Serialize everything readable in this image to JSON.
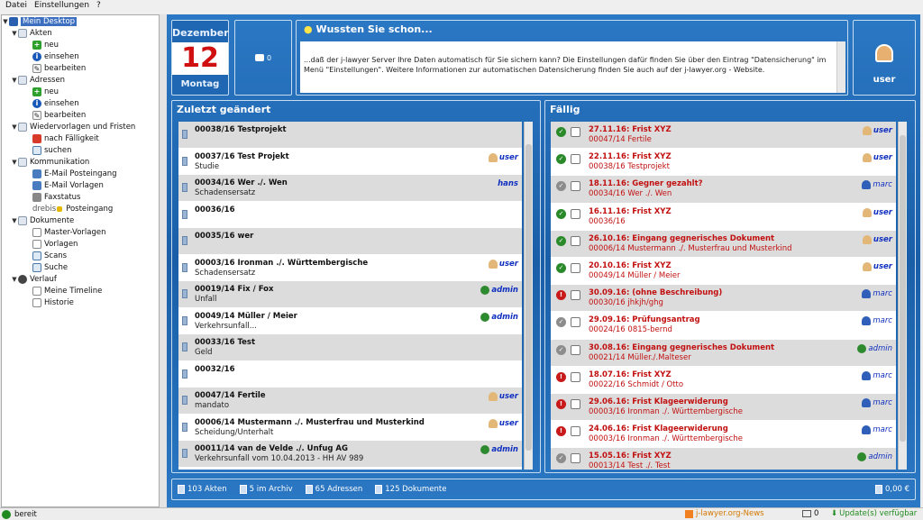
{
  "menu": {
    "file": "Datei",
    "settings": "Einstellungen",
    "help": "?"
  },
  "tree": {
    "root": "Mein Desktop",
    "akten": {
      "label": "Akten",
      "neu": "neu",
      "einsehen": "einsehen",
      "bearbeiten": "bearbeiten"
    },
    "adressen": {
      "label": "Adressen",
      "neu": "neu",
      "einsehen": "einsehen",
      "bearbeiten": "bearbeiten"
    },
    "wv": {
      "label": "Wiedervorlagen und Fristen",
      "faellig": "nach Fälligkeit",
      "suchen": "suchen"
    },
    "komm": {
      "label": "Kommunikation",
      "email_in": "E-Mail Posteingang",
      "email_tpl": "E-Mail Vorlagen",
      "fax": "Faxstatus",
      "drebis_prefix": "drebis",
      "drebis": "Posteingang"
    },
    "docs": {
      "label": "Dokumente",
      "master": "Master-Vorlagen",
      "vorlagen": "Vorlagen",
      "scans": "Scans",
      "suche": "Suche"
    },
    "verlauf": {
      "label": "Verlauf",
      "timeline": "Meine Timeline",
      "historie": "Historie"
    }
  },
  "date": {
    "month": "Dezember",
    "day": "12",
    "weekday": "Montag"
  },
  "mail": {
    "count": "0"
  },
  "tip": {
    "title": "Wussten Sie schon...",
    "text": "...daß der j-lawyer Server Ihre Daten automatisch für Sie sichern kann? Die Einstellungen dafür finden Sie über den Eintrag \"Datensicherung\" im Menü \"Einstellungen\". Weitere Informationen zur automatischen Datensicherung finden Sie auch auf der j-lawyer.org - Website."
  },
  "user": {
    "name": "user"
  },
  "recent": {
    "title": "Zuletzt geändert",
    "rows": [
      {
        "title": "00038/16 Testprojekt",
        "sub": "",
        "user": ""
      },
      {
        "title": "00037/16 Test Projekt",
        "sub": "Studie",
        "user": "user",
        "utype": "user"
      },
      {
        "title": "00034/16 Wer ./. Wen",
        "sub": "Schadensersatz",
        "user": "hans",
        "utype": ""
      },
      {
        "title": "00036/16",
        "sub": "",
        "user": ""
      },
      {
        "title": "00035/16 wer",
        "sub": "",
        "user": ""
      },
      {
        "title": "00003/16 Ironman ./. Württembergische",
        "sub": "Schadensersatz",
        "user": "user",
        "utype": "user"
      },
      {
        "title": "00019/14 Fix / Fox",
        "sub": "Unfall",
        "user": "admin",
        "utype": "admin"
      },
      {
        "title": "00049/14 Müller / Meier",
        "sub": "Verkehrsunfall...",
        "user": "admin",
        "utype": "admin"
      },
      {
        "title": "00033/16 Test",
        "sub": "Geld",
        "user": ""
      },
      {
        "title": "00032/16",
        "sub": "",
        "user": ""
      },
      {
        "title": "00047/14 Fertile",
        "sub": "mandato",
        "user": "user",
        "utype": "user"
      },
      {
        "title": "00006/14 Mustermann ./. Musterfrau und Musterkind",
        "sub": "Scheidung/Unterhalt",
        "user": "user",
        "utype": "user"
      },
      {
        "title": "00011/14 van de Velde ./. Unfug AG",
        "sub": "Verkehrsunfall vom 10.04.2013 - HH AV 989",
        "user": "admin",
        "utype": "admin"
      }
    ]
  },
  "due": {
    "title": "Fällig",
    "rows": [
      {
        "title": "27.11.16: Frist XYZ",
        "sub": "00047/14 Fertile",
        "user": "user",
        "utype": "user",
        "status": "green"
      },
      {
        "title": "22.11.16: Frist XYZ",
        "sub": "00038/16 Testprojekt",
        "user": "user",
        "utype": "user",
        "status": "green"
      },
      {
        "title": "18.11.16: Gegner gezahlt?",
        "sub": "00034/16 Wer ./. Wen",
        "user": "marc",
        "utype": "marc",
        "status": "gray"
      },
      {
        "title": "16.11.16: Frist XYZ",
        "sub": "00036/16",
        "user": "user",
        "utype": "user",
        "status": "green"
      },
      {
        "title": "26.10.16: Eingang gegnerisches Dokument",
        "sub": "00006/14 Mustermann ./. Musterfrau und Musterkind",
        "user": "user",
        "utype": "user",
        "status": "green"
      },
      {
        "title": "20.10.16: Frist XYZ",
        "sub": "00049/14 Müller / Meier",
        "user": "user",
        "utype": "user",
        "status": "green"
      },
      {
        "title": "30.09.16: (ohne Beschreibung)",
        "sub": "00030/16 jhkjh/ghg",
        "user": "marc",
        "utype": "marc",
        "status": "red"
      },
      {
        "title": "29.09.16: Prüfungsantrag",
        "sub": "00024/16 0815-bernd",
        "user": "marc",
        "utype": "marc",
        "status": "gray"
      },
      {
        "title": "30.08.16: Eingang gegnerisches Dokument",
        "sub": "00021/14 Müller./.Malteser",
        "user": "admin",
        "utype": "admin",
        "status": "gray"
      },
      {
        "title": "18.07.16: Frist XYZ",
        "sub": "00022/16 Schmidt / Otto",
        "user": "marc",
        "utype": "marc",
        "status": "red"
      },
      {
        "title": "29.06.16: Frist Klageerwiderung",
        "sub": "00003/16 Ironman ./. Württembergische",
        "user": "marc",
        "utype": "marc",
        "status": "red"
      },
      {
        "title": "24.06.16: Frist Klageerwiderung",
        "sub": "00003/16 Ironman ./. Württembergische",
        "user": "marc",
        "utype": "marc",
        "status": "red"
      },
      {
        "title": "15.05.16: Frist XYZ",
        "sub": "00013/14 Test ./. Test",
        "user": "admin",
        "utype": "admin",
        "status": "gray"
      }
    ]
  },
  "stats": {
    "akten": "103 Akten",
    "archiv": "5 im Archiv",
    "adressen": "65 Adressen",
    "dokumente": "125 Dokumente",
    "amount": "0,00 €"
  },
  "statusbar": {
    "state": "bereit",
    "news": "j-lawyer.org-News",
    "mails": "0",
    "update": "Update(s) verfügbar"
  }
}
